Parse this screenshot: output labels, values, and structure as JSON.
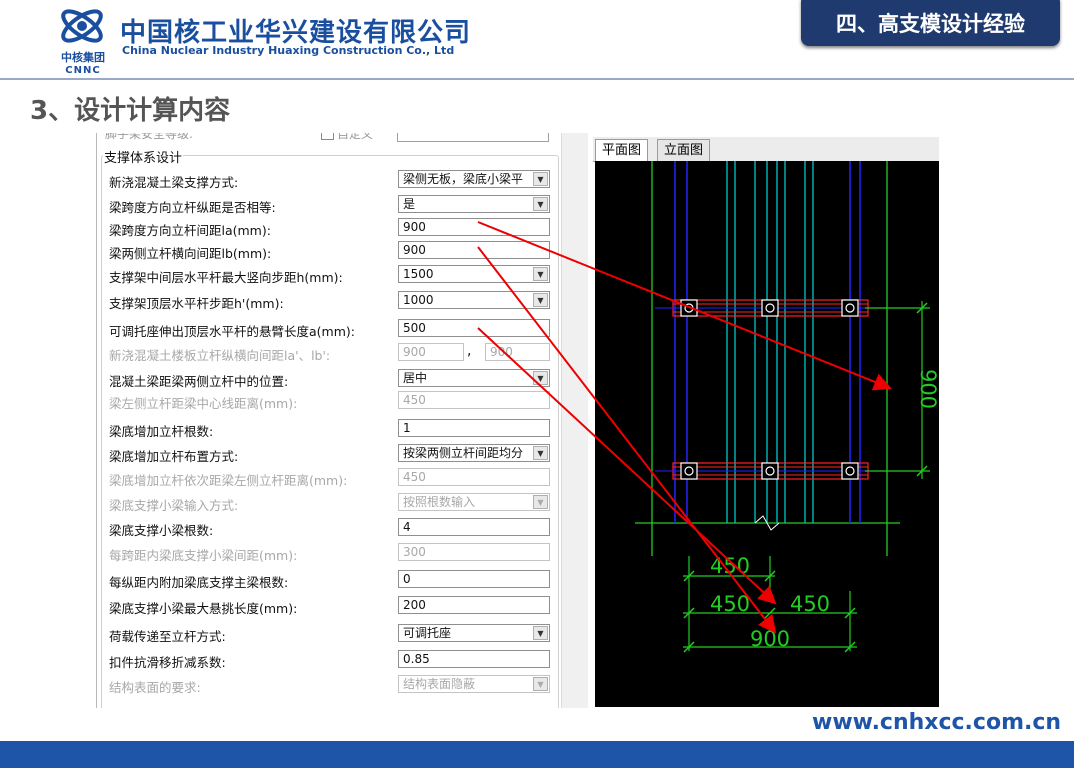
{
  "header": {
    "company_cn": "中国核工业华兴建设有限公司",
    "company_en": "China Nuclear Industry Huaxing Construction Co., Ltd",
    "logo_group": "中核集团",
    "logo_abbr": "CNNC",
    "section": "四、高支模设计经验",
    "page_title": "3、设计计算内容",
    "brand_color": "#1a4fa0"
  },
  "form": {
    "cut_row": {
      "label": "脚手架安全等级:",
      "checkbox_label": "自定义"
    },
    "group_title": "支撑体系设计",
    "rows": [
      {
        "label": "新浇混凝土梁支撑方式:",
        "value": "梁侧无板，梁底小梁平",
        "type": "combo"
      },
      {
        "label": "梁跨度方向立杆纵距是否相等:",
        "value": "是",
        "type": "combo"
      },
      {
        "label": "梁跨度方向立杆间距la(mm):",
        "value": "900",
        "type": "text"
      },
      {
        "label": "梁两侧立杆横向间距lb(mm):",
        "value": "900",
        "type": "text"
      },
      {
        "label": "支撑架中间层水平杆最大竖向步距h(mm):",
        "value": "1500",
        "type": "combo"
      },
      {
        "label": "支撑架顶层水平杆步距h'(mm):",
        "value": "1000",
        "type": "combo"
      },
      {
        "label": "可调托座伸出顶层水平杆的悬臂长度a(mm):",
        "value": "500",
        "type": "text"
      },
      {
        "label": "新浇混凝土楼板立杆纵横向间距la'、lb':",
        "value": "900",
        "value2": "900",
        "type": "pair",
        "disabled": true
      },
      {
        "label": "混凝土梁距梁两侧立杆中的位置:",
        "value": "居中",
        "type": "combo"
      },
      {
        "label": "梁左侧立杆距梁中心线距离(mm):",
        "value": "450",
        "type": "text",
        "disabled": true
      },
      {
        "label": "梁底增加立杆根数:",
        "value": "1",
        "type": "text"
      },
      {
        "label": "梁底增加立杆布置方式:",
        "value": "按梁两侧立杆间距均分",
        "type": "combo"
      },
      {
        "label": "梁底增加立杆依次距梁左侧立杆距离(mm):",
        "value": "450",
        "type": "text",
        "disabled": true
      },
      {
        "label": "梁底支撑小梁输入方式:",
        "value": "按照根数输入",
        "type": "combo",
        "disabled": true
      },
      {
        "label": "梁底支撑小梁根数:",
        "value": "4",
        "type": "text"
      },
      {
        "label": "每跨距内梁底支撑小梁间距(mm):",
        "value": "300",
        "type": "text",
        "disabled": true
      },
      {
        "label": "每纵距内附加梁底支撑主梁根数:",
        "value": "0",
        "type": "text"
      },
      {
        "label": "梁底支撑小梁最大悬挑长度(mm):",
        "value": "200",
        "type": "text"
      },
      {
        "label": "荷载传递至立杆方式:",
        "value": "可调托座",
        "type": "combo"
      },
      {
        "label": "扣件抗滑移折减系数:",
        "value": "0.85",
        "type": "text"
      },
      {
        "label": "结构表面的要求:",
        "value": "结构表面隐蔽",
        "type": "combo",
        "disabled": true
      }
    ]
  },
  "cad": {
    "tabs": [
      "平面图",
      "立面图"
    ],
    "active_tab": 0,
    "dims": {
      "vertical": "900",
      "top": "450",
      "left": "450",
      "right": "450",
      "bottom": "900"
    },
    "colors": {
      "background": "#000000",
      "dimension": "#22cc22",
      "pole": "#2222ff",
      "beam": "#00c8c8",
      "bar": "#ff2222",
      "arrow": "#ee0000"
    }
  },
  "footer": {
    "url": "www.cnhxcc.com.cn"
  }
}
